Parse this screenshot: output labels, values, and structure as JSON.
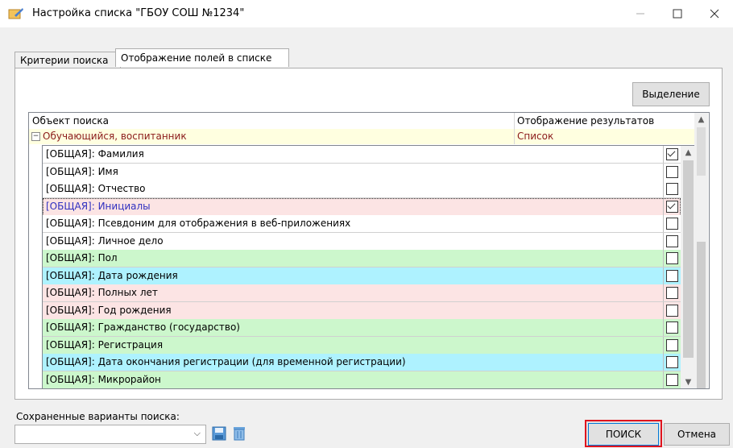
{
  "window": {
    "title": "Настройка списка \"ГБОУ СОШ №1234\""
  },
  "tabs": [
    {
      "label": "Критерии поиска"
    },
    {
      "label": "Отображение полей в списке"
    }
  ],
  "toolbar": {
    "select_label": "Выделение"
  },
  "grid": {
    "columns": [
      "Объект поиска",
      "Отображение результатов"
    ],
    "parent": {
      "label": "Обучающийся, воспитанник",
      "display": "Список"
    },
    "rows": [
      {
        "label": "[ОБЩАЯ]: Фамилия",
        "checked": true,
        "color": "#ffffff"
      },
      {
        "label": "[ОБЩАЯ]: Имя",
        "checked": false,
        "color": "#ffffff"
      },
      {
        "label": "[ОБЩАЯ]: Отчество",
        "checked": false,
        "color": "#ffffff"
      },
      {
        "label": "[ОБЩАЯ]: Инициалы",
        "checked": true,
        "color": "#fce4e4",
        "selected": true
      },
      {
        "label": "[ОБЩАЯ]: Псевдоним для отображения в веб-приложениях",
        "checked": false,
        "color": "#ffffff"
      },
      {
        "label": "[ОБЩАЯ]: Личное дело",
        "checked": false,
        "color": "#ffffff"
      },
      {
        "label": "[ОБЩАЯ]: Пол",
        "checked": false,
        "color": "#ccf7cc"
      },
      {
        "label": "[ОБЩАЯ]: Дата рождения",
        "checked": false,
        "color": "#aef2ff"
      },
      {
        "label": "[ОБЩАЯ]: Полных лет",
        "checked": false,
        "color": "#fce4e4"
      },
      {
        "label": "[ОБЩАЯ]: Год рождения",
        "checked": false,
        "color": "#fce4e4"
      },
      {
        "label": "[ОБЩАЯ]: Гражданство (государство)",
        "checked": false,
        "color": "#ccf7cc"
      },
      {
        "label": "[ОБЩАЯ]: Регистрация",
        "checked": false,
        "color": "#ccf7cc"
      },
      {
        "label": "[ОБЩАЯ]: Дата окончания регистрации (для временной регистрации)",
        "checked": false,
        "color": "#aef2ff"
      },
      {
        "label": "[ОБЩАЯ]: Микрорайон",
        "checked": false,
        "color": "#ccf7cc"
      }
    ]
  },
  "footer": {
    "saved_label": "Сохраненные варианты поиска:",
    "saved_value": "",
    "search_label": "ПОИСК",
    "cancel_label": "Отмена"
  }
}
